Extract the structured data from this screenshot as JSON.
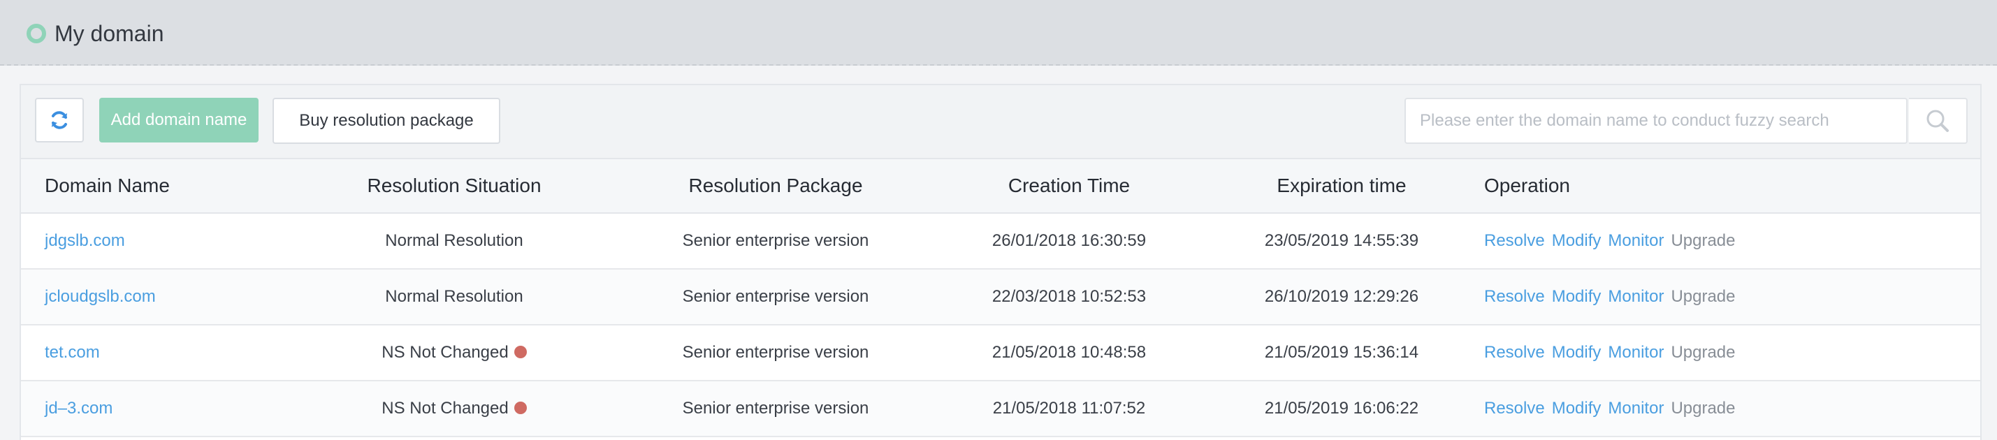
{
  "header": {
    "title": "My domain"
  },
  "toolbar": {
    "refresh_icon": "refresh-icon",
    "add_label": "Add domain name",
    "buy_label": "Buy resolution package",
    "search_placeholder": "Please enter the domain name to conduct fuzzy search",
    "search_value": "",
    "search_icon": "search-icon"
  },
  "table": {
    "columns": [
      "Domain Name",
      "Resolution Situation",
      "Resolution Package",
      "Creation Time",
      "Expiration time",
      "Operation"
    ],
    "rows": [
      {
        "domain": "jdgslb.com",
        "situation": "Normal Resolution",
        "warning": false,
        "package": "Senior enterprise version",
        "created": "26/01/2018 16:30:59",
        "expires": "23/05/2019 14:55:39"
      },
      {
        "domain": "jcloudgslb.com",
        "situation": "Normal Resolution",
        "warning": false,
        "package": "Senior enterprise version",
        "created": "22/03/2018 10:52:53",
        "expires": "26/10/2019 12:29:26"
      },
      {
        "domain": "tet.com",
        "situation": "NS Not Changed",
        "warning": true,
        "package": "Senior enterprise version",
        "created": "21/05/2018 10:48:58",
        "expires": "21/05/2019 15:36:14"
      },
      {
        "domain": "jd–3.com",
        "situation": "NS Not Changed",
        "warning": true,
        "package": "Senior enterprise version",
        "created": "21/05/2018 11:07:52",
        "expires": "21/05/2019 16:06:22"
      }
    ],
    "operations": {
      "resolve": "Resolve",
      "modify": "Modify",
      "monitor": "Monitor",
      "upgrade": "Upgrade"
    }
  },
  "colors": {
    "accent": "#8fd3b8",
    "link": "#4a9ee0",
    "warning_dot": "#cf6a62",
    "muted_link": "#888e96"
  }
}
